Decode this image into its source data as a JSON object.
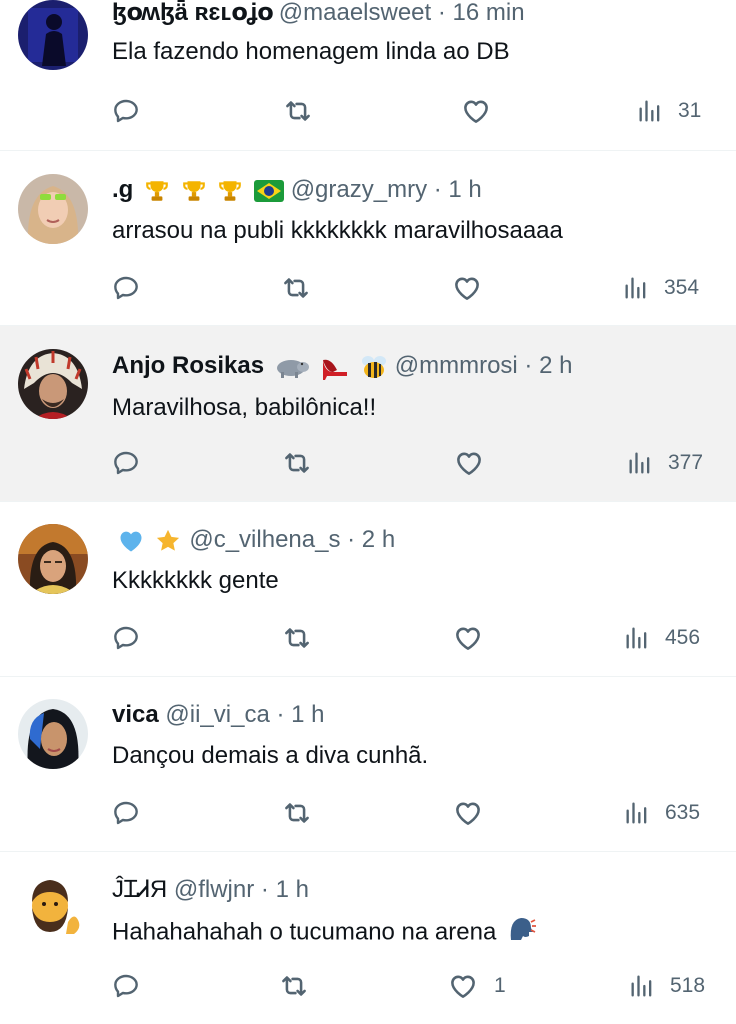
{
  "feed": [
    {
      "name": "ɮօʍɮǟ ʀɛʟօʝօ",
      "handle": "@maaelsweet",
      "time": "· 16 min",
      "text": "Ela fazendo homenagem linda ao DB",
      "avatar": "dark-figure-avatar",
      "name_emojis": [],
      "text_emoji": null,
      "likes": "",
      "views": "31"
    },
    {
      "name": ".g",
      "handle": "@grazy_mry",
      "time": "· 1 h",
      "text": "arrasou na publi kkkkkkkk maravilhosaaaa",
      "avatar": "girl-sunglasses-avatar",
      "name_emojis": [
        "trophy-icon",
        "trophy-icon",
        "trophy-icon",
        "brazil-flag-icon"
      ],
      "text_emoji": null,
      "likes": "",
      "views": "354"
    },
    {
      "name": "Anjo Rosikas",
      "handle": "@mmmrosi",
      "time": "· 2 h",
      "text": "Maravilhosa, babilônica!!",
      "avatar": "headdress-man-avatar",
      "name_emojis": [
        "hippo-icon",
        "high-heel-icon",
        "bee-icon"
      ],
      "text_emoji": null,
      "likes": "",
      "views": "377"
    },
    {
      "name": "",
      "handle": "@c_vilhena_s",
      "time": "· 2 h",
      "text": "Kkkkkkkk gente",
      "avatar": "girl-selfie-avatar",
      "name_emojis": [
        "blue-heart-icon",
        "star-icon"
      ],
      "text_emoji": null,
      "likes": "",
      "views": "456"
    },
    {
      "name": "vica",
      "handle": "@ii_vi_ca",
      "time": "· 1 h",
      "text": "Dançou demais a diva cunhã.",
      "avatar": "woman-blue-hair-avatar",
      "name_emojis": [],
      "text_emoji": null,
      "likes": "",
      "views": "635"
    },
    {
      "name": "ĴꞮᏗЯ",
      "handle": "@flwjnr",
      "time": "· 1 h",
      "text": "Hahahahahah o tucumano na arena",
      "avatar": "bearded-emoji-avatar",
      "name_emojis": [],
      "text_emoji": "speaking-head-icon",
      "likes": "1",
      "views": "518"
    }
  ],
  "colors": {
    "text": "#0f1419",
    "secondary": "#536471",
    "divider": "#eff3f4",
    "highlight_bg": "#f2f2f2"
  }
}
